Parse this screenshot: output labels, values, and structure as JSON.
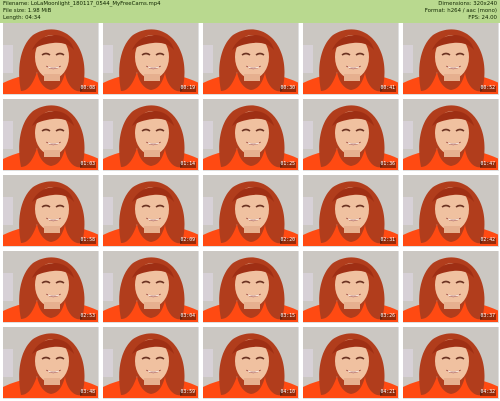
{
  "header": {
    "lines_left": [
      "Filename: LoLaMoonlight_180117_0544_MyFreeCams.mp4",
      "File size: 1.98 MiB",
      "Length: 04:34"
    ],
    "lines_right": [
      "Dimensions: 320x240",
      "Format: h264 / aac (mono)",
      "FPS: 24.00"
    ]
  },
  "thumbnails": [
    {
      "timecode": "00:08"
    },
    {
      "timecode": "00:19"
    },
    {
      "timecode": "00:30"
    },
    {
      "timecode": "00:41"
    },
    {
      "timecode": "00:52"
    },
    {
      "timecode": "01:03"
    },
    {
      "timecode": "01:14"
    },
    {
      "timecode": "01:25"
    },
    {
      "timecode": "01:36"
    },
    {
      "timecode": "01:47"
    },
    {
      "timecode": "01:58"
    },
    {
      "timecode": "02:09"
    },
    {
      "timecode": "02:20"
    },
    {
      "timecode": "02:31"
    },
    {
      "timecode": "02:42"
    },
    {
      "timecode": "02:53"
    },
    {
      "timecode": "03:04"
    },
    {
      "timecode": "03:15"
    },
    {
      "timecode": "03:26"
    },
    {
      "timecode": "03:37"
    },
    {
      "timecode": "03:48"
    },
    {
      "timecode": "03:59"
    },
    {
      "timecode": "04:10"
    },
    {
      "timecode": "04:21"
    },
    {
      "timecode": "04:32"
    }
  ],
  "colors": {
    "header_bg": "#b9d98f",
    "header_text": "#102500",
    "wall_bg": "#cbc7c2",
    "hair": "#b13d1c",
    "skin": "#f0c1a0",
    "shirt": "#ff4a12"
  }
}
